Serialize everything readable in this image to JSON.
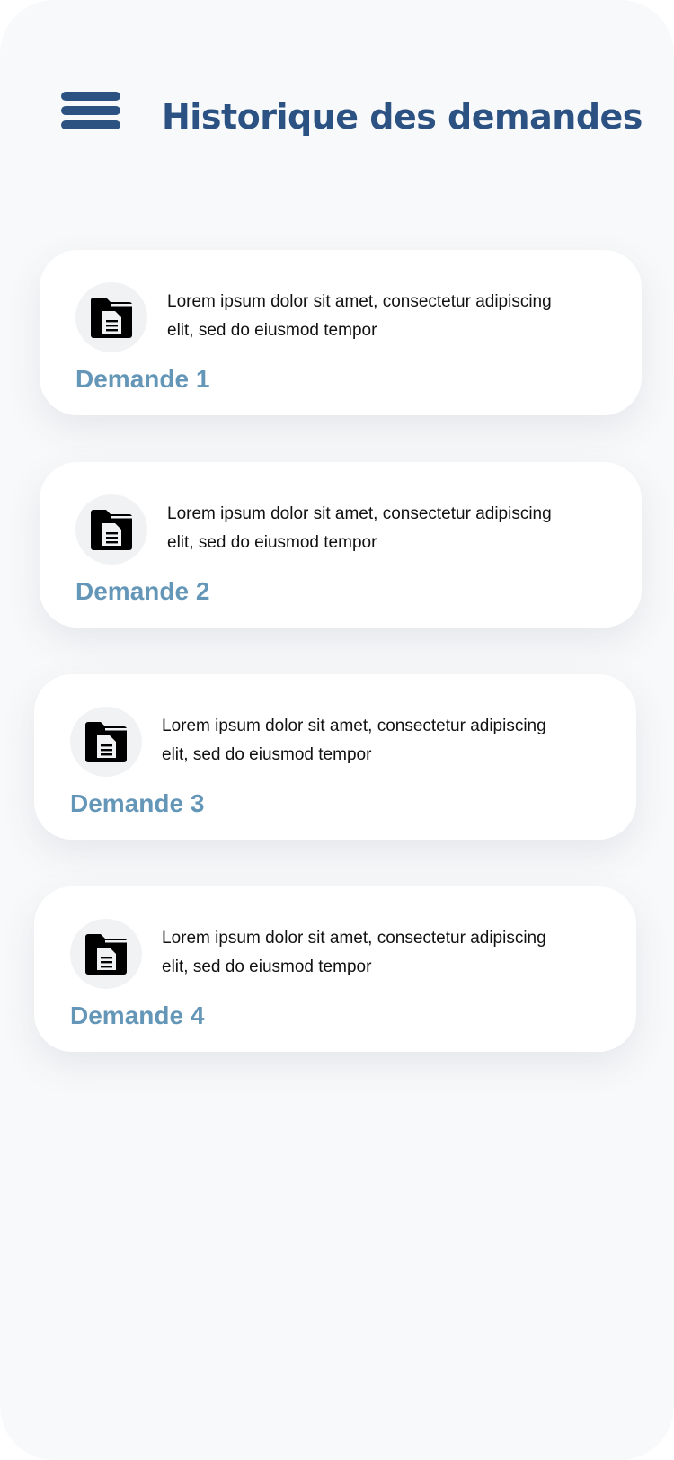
{
  "header": {
    "menu_icon": "hamburger-menu-icon",
    "title": "Historique des demandes",
    "accent_color": "#2b5283"
  },
  "requests": [
    {
      "icon": "document-folder-icon",
      "description": "Lorem ipsum dolor sit amet, consectetur adipiscing elit, sed do eiusmod tempor",
      "title": "Demande 1"
    },
    {
      "icon": "document-folder-icon",
      "description": "Lorem ipsum dolor sit amet, consectetur adipiscing elit, sed do eiusmod tempor",
      "title": "Demande 2"
    },
    {
      "icon": "document-folder-icon",
      "description": "Lorem ipsum dolor sit amet, consectetur adipiscing elit, sed do eiusmod tempor",
      "title": "Demande 3"
    },
    {
      "icon": "document-folder-icon",
      "description": "Lorem ipsum dolor sit amet, consectetur adipiscing elit, sed do eiusmod tempor",
      "title": "Demande 4"
    }
  ],
  "colors": {
    "card_title": "#6496b8",
    "background": "#f8f9fa",
    "card_background": "#ffffff"
  }
}
